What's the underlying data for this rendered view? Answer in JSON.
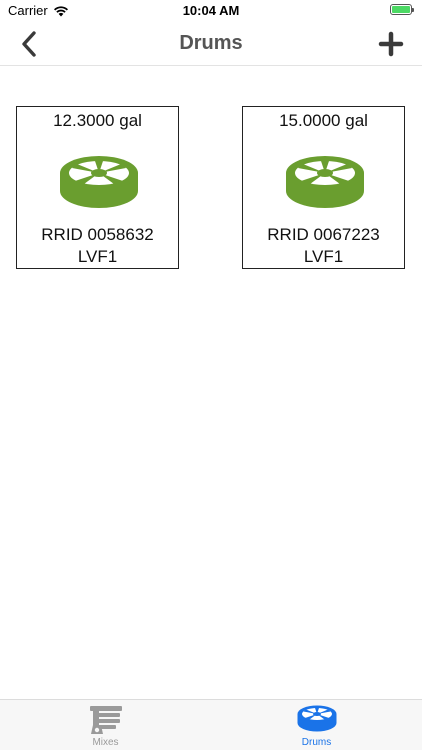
{
  "status_bar": {
    "carrier": "Carrier",
    "time": "10:04 AM"
  },
  "nav": {
    "title": "Drums"
  },
  "drums": [
    {
      "volume": "12.3000 gal",
      "rrid": "RRID 0058632",
      "code": "LVF1"
    },
    {
      "volume": "15.0000 gal",
      "rrid": "RRID 0067223",
      "code": "LVF1"
    }
  ],
  "tabs": [
    {
      "label": "Mixes",
      "icon": "mixer-icon",
      "selected": false
    },
    {
      "label": "Drums",
      "icon": "drum-icon",
      "selected": true
    }
  ],
  "colors": {
    "drum_green": "#6a9e2f",
    "tab_active": "#1a73e8",
    "tab_inactive": "#9a9a9a"
  }
}
